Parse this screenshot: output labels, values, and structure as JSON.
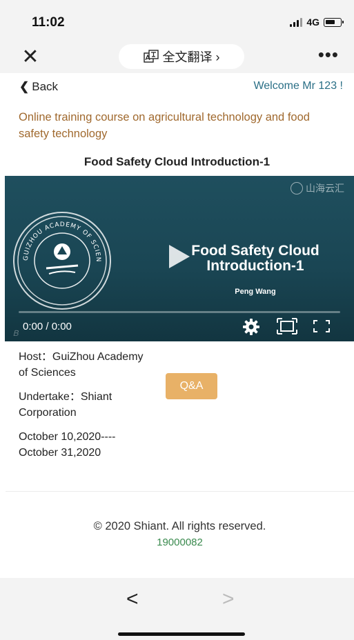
{
  "status_bar": {
    "time": "11:02",
    "network": "4G"
  },
  "nav_bar": {
    "translate_label": "全文翻译 ›",
    "more_label": "•••"
  },
  "top_bar": {
    "back_label": "Back",
    "welcome_text": "Welcome Mr 123 !"
  },
  "course": {
    "title": "Online training course on agricultural technology and food safety technology",
    "video_title": "Food Safety Cloud Introduction-1"
  },
  "video": {
    "watermark_text": "山海云汇",
    "slide_title_line1": "Food Safety Cloud",
    "slide_title_line2": "Introduction-1",
    "presenter": "Peng Wang",
    "time_readout": "0:00 / 0:00",
    "progress": 0,
    "seal_text": "GUIZHOU ACADEMY OF SCIENCES"
  },
  "details": {
    "host": "Host：GuiZhou Academy of Sciences",
    "undertake": "Undertake：Shiant Corporation",
    "dates": "October 10,2020----October 31,2020",
    "qa_label": "Q&A"
  },
  "footer": {
    "copyright": "© 2020 Shiant. All rights reserved.",
    "id": "19000082"
  },
  "browser_nav": {
    "back_symbol": "<",
    "forward_symbol": ">"
  },
  "colors": {
    "course_title": "#a0692e",
    "welcome": "#2a6f86",
    "qa_button": "#e8b167",
    "footer_id": "#3a8a4e",
    "video_bg": "#1a4654"
  },
  "icons": {
    "close": "close-icon",
    "translate": "translate-icon",
    "more": "more-icon",
    "back": "chevron-left-icon",
    "play": "play-icon",
    "settings": "gear-icon",
    "fit": "fit-screen-icon",
    "fullscreen": "fullscreen-icon"
  }
}
